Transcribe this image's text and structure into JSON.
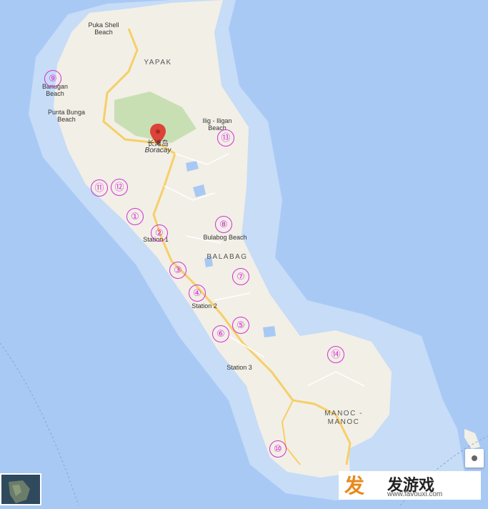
{
  "map": {
    "area_labels": {
      "yapak": "YAPAK",
      "balabag": "BALABAG",
      "manoc": "MANOC -\nMANOC"
    },
    "place_labels": {
      "puka_shell_beach": "Puka Shell\nBeach",
      "balinghai_beach": "Banugan\nBeach",
      "punta_bunga_beach": "Punta Bunga\nBeach",
      "ilig_iligan_beach": "Ilig - Iligan\nBeach",
      "bulabog_beach": "Bulabog Beach",
      "station_1": "Station 1",
      "station_2": "Station 2",
      "station_3": "Station 3"
    },
    "pin": {
      "title": "长滩岛",
      "subtitle": "Boracay",
      "color": "#db4437"
    },
    "markers": [
      "①",
      "②",
      "③",
      "④",
      "⑤",
      "⑥",
      "⑦",
      "⑧",
      "⑨",
      "⑩",
      "⑪",
      "⑫",
      "⑬",
      "⑭"
    ],
    "colors": {
      "water": "#a9c9f5",
      "shallow": "#c6dcf7",
      "land": "#f2efe6",
      "park": "#c8dfb4",
      "road": "#f6cf68",
      "marker": "#d22fd6"
    }
  },
  "controls": {
    "location_icon": "my-location-icon",
    "satellite_thumb_icon": "satellite-thumbnail"
  },
  "watermark": {
    "main": "发游戏",
    "url": "www.favouxi.com"
  }
}
